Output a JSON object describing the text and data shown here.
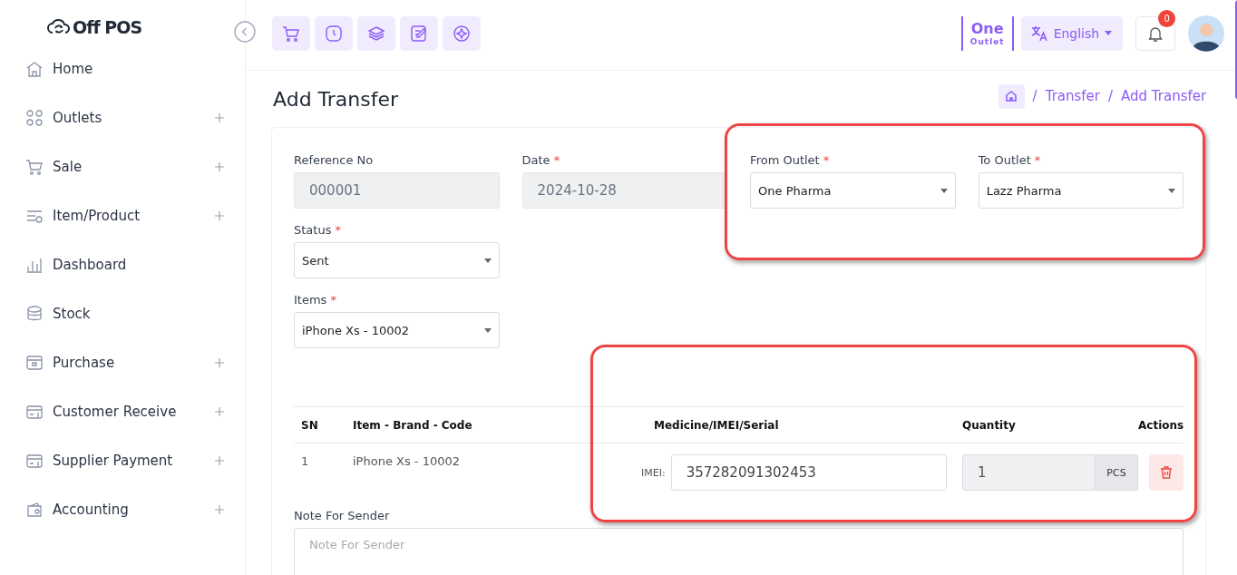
{
  "brand": {
    "name": "Off POS"
  },
  "outlet": {
    "name": "One",
    "label": "Outlet"
  },
  "language": {
    "label": "English"
  },
  "notifications": {
    "count": "0"
  },
  "sidebar": {
    "items": [
      {
        "label": "Home",
        "expandable": false
      },
      {
        "label": "Outlets",
        "expandable": true
      },
      {
        "label": "Sale",
        "expandable": true
      },
      {
        "label": "Item/Product",
        "expandable": true
      },
      {
        "label": "Dashboard",
        "expandable": false
      },
      {
        "label": "Stock",
        "expandable": false
      },
      {
        "label": "Purchase",
        "expandable": true
      },
      {
        "label": "Customer Receive",
        "expandable": true
      },
      {
        "label": "Supplier Payment",
        "expandable": true
      },
      {
        "label": "Accounting",
        "expandable": true
      }
    ]
  },
  "page": {
    "title": "Add Transfer",
    "breadcrumb": [
      {
        "separator": "/",
        "label": "Transfer"
      },
      {
        "separator": "/",
        "label": "Add Transfer"
      }
    ]
  },
  "form": {
    "fields": [
      {
        "label": "Reference No",
        "kind": "text",
        "value": "000001",
        "disabled": true
      },
      {
        "label": "Date",
        "required_mark": "*",
        "kind": "text",
        "value": "2024-10-28",
        "disabled": true
      },
      {
        "label": "From Outlet",
        "required_mark": "*",
        "kind": "select",
        "value": "One Pharma"
      },
      {
        "label": "To Outlet",
        "required_mark": "*",
        "kind": "select",
        "value": "Lazz Pharma"
      },
      {
        "label": "Status",
        "required_mark": "*",
        "kind": "select",
        "value": "Sent"
      },
      {
        "label": "Items",
        "required_mark": "*",
        "kind": "select",
        "value": "iPhone Xs - 10002"
      }
    ]
  },
  "table": {
    "columns": [
      "SN",
      "Item - Brand - Code",
      "Medicine/IMEI/Serial",
      "Quantity",
      "Actions"
    ],
    "rows": [
      {
        "sn": "1",
        "item": "iPhone Xs - 10002",
        "serial_label": "IMEI:",
        "serial": "357282091302453",
        "quantity": "1",
        "unit": "PCS"
      }
    ]
  },
  "note": {
    "label": "Note For Sender",
    "placeholder": "Note For Sender"
  }
}
